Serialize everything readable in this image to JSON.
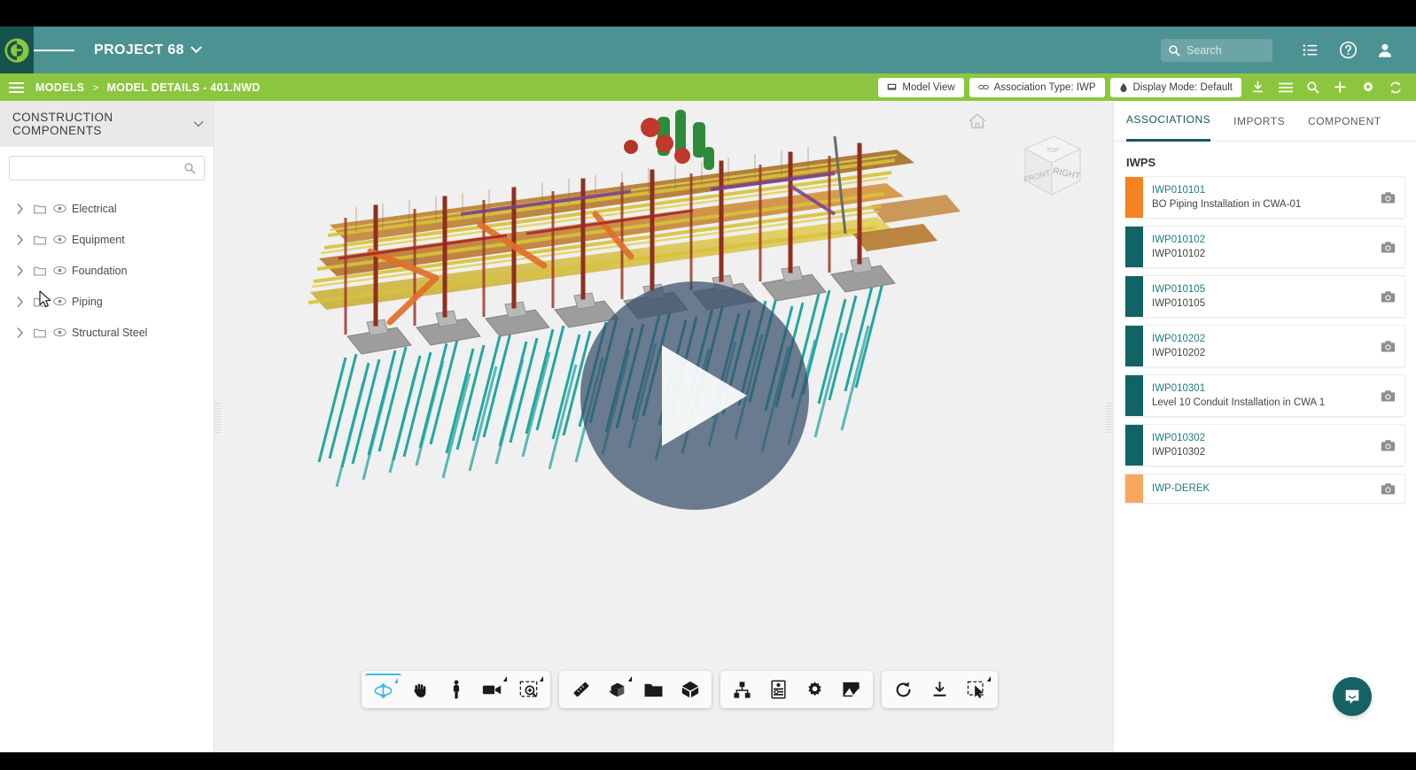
{
  "header": {
    "logo_icon": "company-logo-icon",
    "menu_icon": "hamburger-menu-icon",
    "project_title": "PROJECT 68",
    "project_caret_icon": "chevron-down-icon",
    "search": {
      "placeholder": "Search",
      "value": "",
      "icon": "search-icon"
    },
    "list_icon": "list-icon",
    "help_icon": "help-circle-icon",
    "user_icon": "user-avatar-icon",
    "bg_color": "#4d9293",
    "logo_bg_color": "#16534f"
  },
  "subheader": {
    "menu_icon": "hamburger-menu-icon",
    "breadcrumb": {
      "root": "MODELS",
      "separator": ">",
      "current": "MODEL DETAILS - 401.NWD"
    },
    "buttons": [
      {
        "label": "Model View",
        "icon": "monitor-icon"
      },
      {
        "label": "Association Type: IWP",
        "icon": "link-icon"
      },
      {
        "label": "Display Mode: Default",
        "icon": "droplet-icon"
      }
    ],
    "icons": [
      "download-icon",
      "list-icon",
      "search-icon",
      "plus-icon",
      "gear-icon",
      "refresh-icon"
    ],
    "bg_color": "#8cc63e"
  },
  "sidebar": {
    "title": "CONSTRUCTION COMPONENTS",
    "caret_icon": "chevron-down-icon",
    "search": {
      "placeholder": "",
      "value": "",
      "icon": "search-icon"
    },
    "tree": [
      {
        "label": "Electrical",
        "expand_icon": "chevron-right-icon",
        "folder_icon": "folder-icon",
        "visibility_icon": "eye-icon"
      },
      {
        "label": "Equipment",
        "expand_icon": "chevron-right-icon",
        "folder_icon": "folder-icon",
        "visibility_icon": "eye-icon"
      },
      {
        "label": "Foundation",
        "expand_icon": "chevron-right-icon",
        "folder_icon": "folder-icon",
        "visibility_icon": "eye-icon"
      },
      {
        "label": "Piping",
        "expand_icon": "chevron-right-icon",
        "folder_icon": "folder-icon",
        "visibility_icon": "eye-icon"
      },
      {
        "label": "Structural Steel",
        "expand_icon": "chevron-right-icon",
        "folder_icon": "folder-icon",
        "visibility_icon": "eye-icon"
      }
    ]
  },
  "viewer": {
    "home_icon": "home-icon",
    "navcube": {
      "front_face": "RIGHT",
      "left_face": "FRONT",
      "top_face": "TOP"
    },
    "play_button": {
      "icon": "play-icon",
      "label": "Play"
    },
    "background_color": "#f0f0f0",
    "model_colors": {
      "steel_orange": "#c97c2c",
      "steel_yellow": "#d8c23a",
      "beam_darkred": "#8e2f21",
      "pad_gray": "#a8a8a8",
      "pile_teal": "#1fa5a0",
      "equipment_green": "#2e8b3a",
      "equipment_red": "#c0392b",
      "purple_accent": "#7b3f8f"
    }
  },
  "toolbar": {
    "groups": [
      {
        "buttons": [
          {
            "name": "orbit-tool",
            "icon": "orbit-icon",
            "active": true,
            "has_caret": true
          },
          {
            "name": "pan-tool",
            "icon": "hand-icon",
            "active": false,
            "has_caret": false
          },
          {
            "name": "walk-tool",
            "icon": "walk-person-icon",
            "active": false,
            "has_caret": false
          },
          {
            "name": "camera-tool",
            "icon": "video-camera-icon",
            "active": false,
            "has_caret": true
          },
          {
            "name": "zoom-window-tool",
            "icon": "zoom-window-icon",
            "active": false,
            "has_caret": true
          }
        ]
      },
      {
        "buttons": [
          {
            "name": "measure-tool",
            "icon": "ruler-icon",
            "active": false,
            "has_caret": false
          },
          {
            "name": "section-tool",
            "icon": "section-box-icon",
            "active": false,
            "has_caret": true
          },
          {
            "name": "folder-tool",
            "icon": "folder-filled-icon",
            "active": false,
            "has_caret": false
          },
          {
            "name": "model-tool",
            "icon": "cube-icon",
            "active": false,
            "has_caret": false
          }
        ]
      },
      {
        "buttons": [
          {
            "name": "hierarchy-tool",
            "icon": "sitemap-icon",
            "active": false,
            "has_caret": false
          },
          {
            "name": "properties-tool",
            "icon": "properties-icon",
            "active": false,
            "has_caret": false
          },
          {
            "name": "settings-tool",
            "icon": "gear-icon",
            "active": false,
            "has_caret": false
          },
          {
            "name": "image-tool",
            "icon": "image-export-icon",
            "active": false,
            "has_caret": false
          }
        ]
      },
      {
        "buttons": [
          {
            "name": "reset-tool",
            "icon": "rotate-ccw-icon",
            "active": false,
            "has_caret": false
          },
          {
            "name": "download-tool",
            "icon": "download-icon",
            "active": false,
            "has_caret": false
          },
          {
            "name": "select-tool",
            "icon": "select-cursor-icon",
            "active": false,
            "has_caret": true
          }
        ]
      }
    ]
  },
  "right_panel": {
    "tabs": [
      {
        "label": "ASSOCIATIONS",
        "active": true
      },
      {
        "label": "IMPORTS",
        "active": false
      },
      {
        "label": "COMPONENT",
        "active": false
      }
    ],
    "section_title": "IWPS",
    "accent_color": "#14595a",
    "items": [
      {
        "code": "IWP010101",
        "desc": "BO Piping Installation in CWA-01",
        "color": "#f58220",
        "camera_icon": "camera-icon"
      },
      {
        "code": "IWP010102",
        "desc": "IWP010102",
        "color": "#126366",
        "camera_icon": "camera-icon"
      },
      {
        "code": "IWP010105",
        "desc": "IWP010105",
        "color": "#126366",
        "camera_icon": "camera-icon"
      },
      {
        "code": "IWP010202",
        "desc": "IWP010202",
        "color": "#126366",
        "camera_icon": "camera-icon"
      },
      {
        "code": "IWP010301",
        "desc": "Level 10 Conduit Installation in CWA 1",
        "color": "#126366",
        "camera_icon": "camera-icon"
      },
      {
        "code": "IWP010302",
        "desc": "IWP010302",
        "color": "#126366",
        "camera_icon": "camera-icon"
      },
      {
        "code": "IWP-DEREK",
        "desc": "",
        "color": "#f7a košice",
        "camera_icon": "camera-icon"
      }
    ]
  },
  "chat": {
    "icon": "chat-bubble-icon",
    "color": "#166163"
  },
  "cursor": {
    "icon": "mouse-pointer-icon"
  }
}
